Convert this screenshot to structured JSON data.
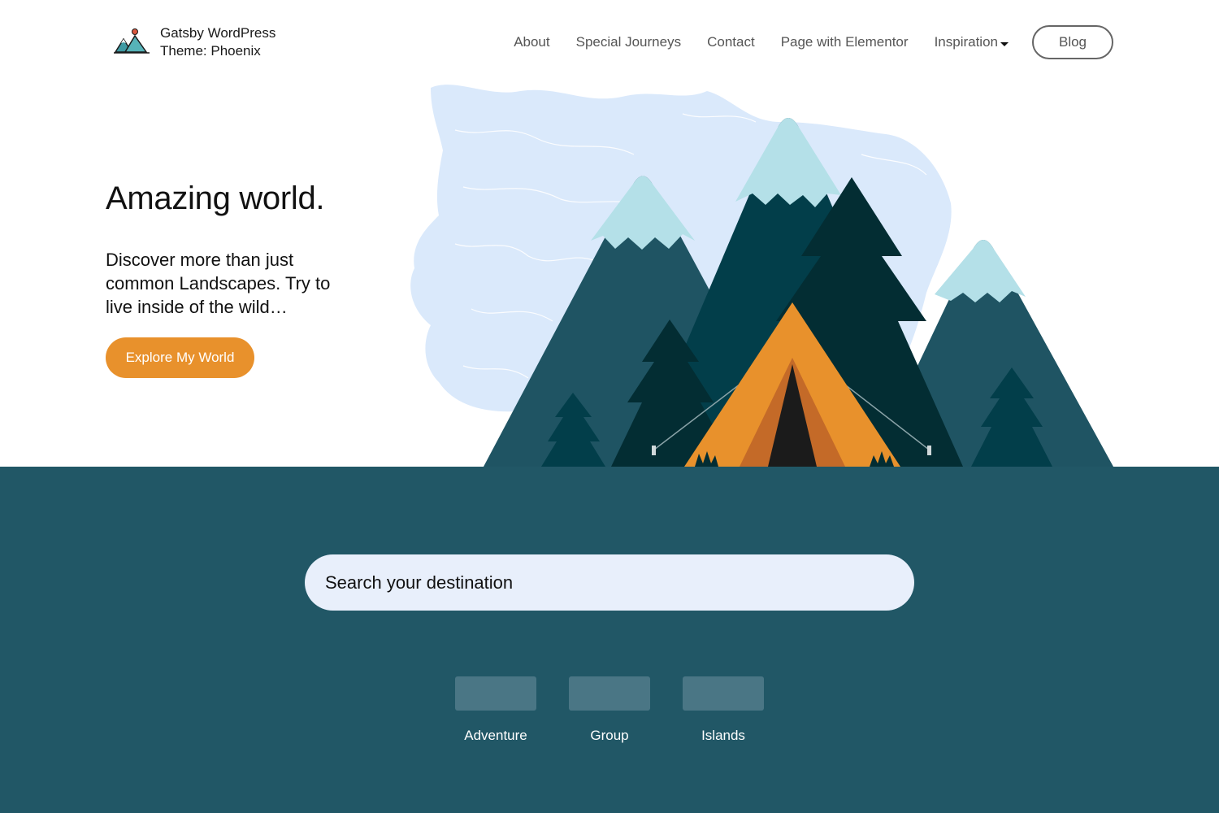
{
  "brand": {
    "title": "Gatsby WordPress Theme: Phoenix",
    "logo_icon": "mountain-logo-icon"
  },
  "nav": {
    "items": [
      {
        "label": "About"
      },
      {
        "label": "Special Journeys"
      },
      {
        "label": "Contact"
      },
      {
        "label": "Page with Elementor"
      },
      {
        "label": "Inspiration",
        "has_dropdown": true
      }
    ],
    "blog_label": "Blog"
  },
  "hero": {
    "title": "Amazing world.",
    "subtitle": "Discover more than just common Landscapes. Try to live inside of the wild…",
    "cta_label": "Explore My World"
  },
  "search": {
    "placeholder": "Search your destination"
  },
  "categories": [
    {
      "label": "Adventure"
    },
    {
      "label": "Group"
    },
    {
      "label": "Islands"
    }
  ],
  "colors": {
    "accent_orange": "#e8912c",
    "band_teal": "#215766",
    "mountain_teal": "#1f5463",
    "mountain_dark": "#023e4a",
    "tree_dark": "#032d33",
    "snow": "#b4e0e8",
    "map_blue": "#dae9fb",
    "search_bg": "#e8effb"
  }
}
